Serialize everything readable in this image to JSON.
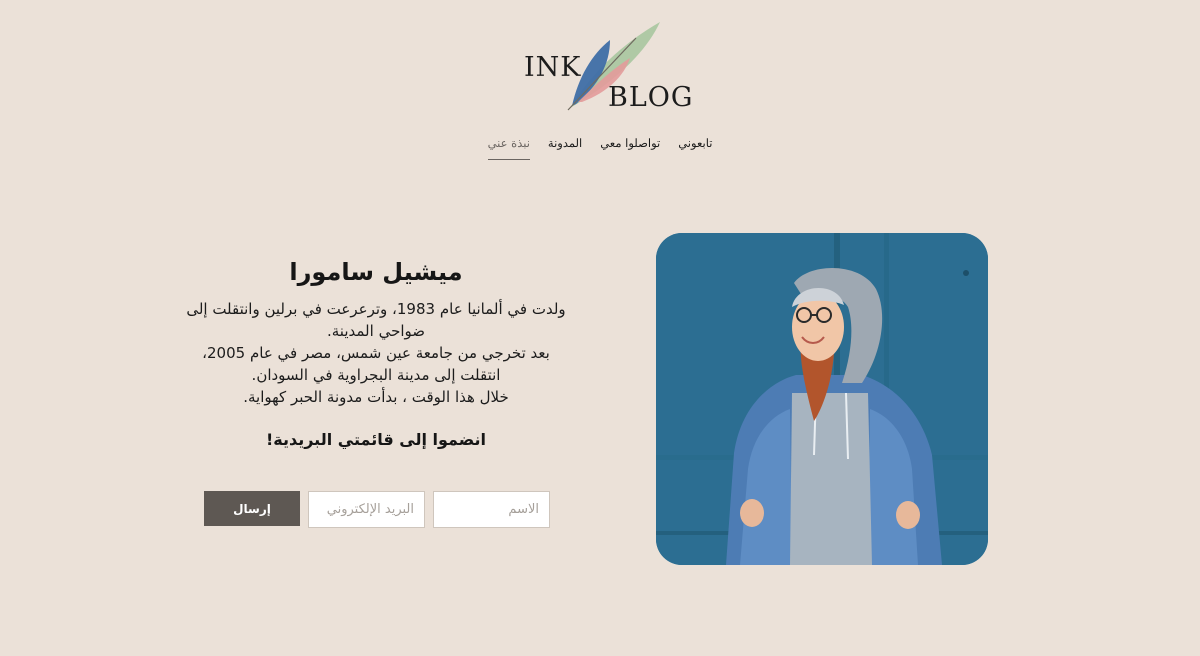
{
  "logo": {
    "word1": "INK",
    "word2": "BLOG",
    "feather_colors": [
      "#a9c7a0",
      "#3f6ea6",
      "#e39b9b"
    ]
  },
  "nav": {
    "items": [
      {
        "label": "نبذة عني",
        "active": true
      },
      {
        "label": "المدونة",
        "active": false
      },
      {
        "label": "تواصلوا معي",
        "active": false
      },
      {
        "label": "تابعوني",
        "active": false
      }
    ]
  },
  "bio": {
    "name": "ميشيل سامورا",
    "lines": [
      "ولدت في ألمانيا عام 1983، وترعرعت في برلين وانتقلت إلى",
      "ضواحي المدينة.",
      "بعد تخرجي من جامعة عين شمس، مصر في عام 2005،",
      "انتقلت إلى مدينة البجراوية في السودان.",
      "خلال هذا الوقت ، بدأت مدونة الحبر كهواية."
    ]
  },
  "newsletter": {
    "title": "انضموا إلى قائمتي البريدية!",
    "name_placeholder": "الاسم",
    "email_placeholder": "البريد الإلكتروني",
    "submit_label": "إرسال"
  },
  "photo": {
    "icon": "portrait-photo",
    "wall_color": "#2f7398"
  }
}
